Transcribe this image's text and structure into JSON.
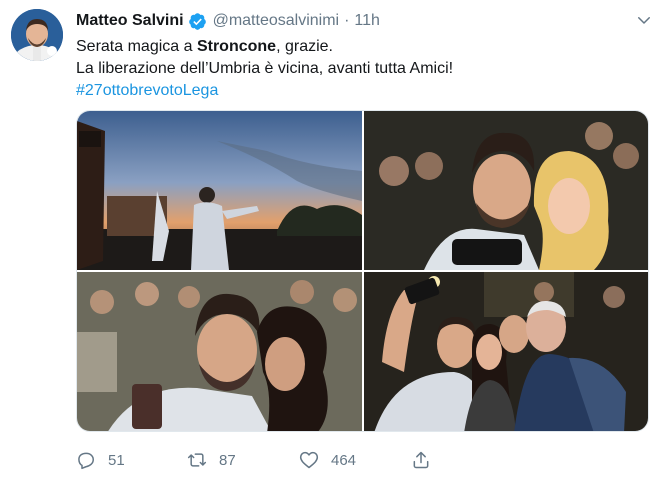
{
  "tweet": {
    "author_name": "Matteo Salvini",
    "handle": "@matteosalvinimi",
    "separator": "·",
    "time": "11h",
    "text_line1_before": "Serata magica a ",
    "text_line1_bold": "Stroncone",
    "text_line1_after": ", grazie.",
    "text_line2": "La liberazione dell’Umbria è vicina, avanti tutta Amici!",
    "hashtag": "#27ottobrevotoLega",
    "icons": {
      "verified": "verified-badge-icon",
      "menu": "chevron-down-icon",
      "reply": "reply-icon",
      "retweet": "retweet-icon",
      "like": "heart-icon",
      "share": "share-icon"
    },
    "colors": {
      "link": "#1b95e0",
      "verified": "#1da1f2",
      "muted": "#657786"
    }
  },
  "actions": {
    "replies": "51",
    "retweets": "87",
    "likes": "464"
  },
  "gallery": {
    "photos": [
      {
        "alt": "photo-stage-sunset"
      },
      {
        "alt": "photo-selfie-blonde-woman"
      },
      {
        "alt": "photo-selfie-dark-hair-woman"
      },
      {
        "alt": "photo-group-selfie"
      }
    ]
  }
}
